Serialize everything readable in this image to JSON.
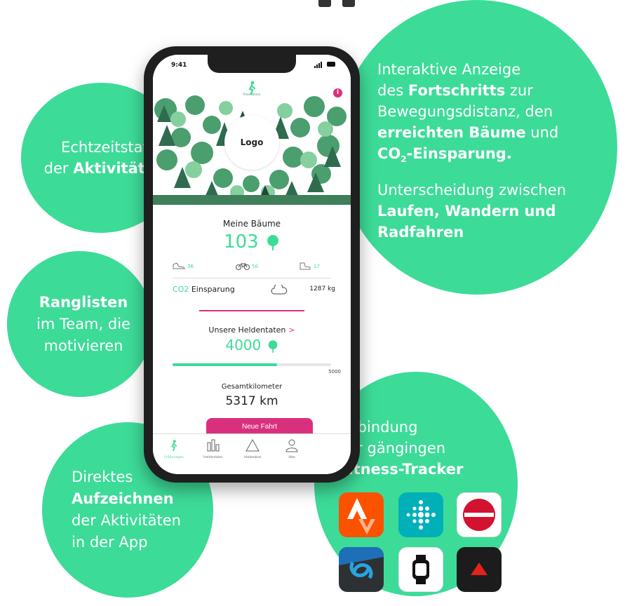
{
  "callouts": {
    "status": {
      "line1": "Echtzeitstatus",
      "line2_prefix": "der ",
      "line2_bold": "Aktivitäten"
    },
    "ranking": {
      "bold": "Ranglisten",
      "line2": "im Team, die",
      "line3": "motivieren"
    },
    "record": {
      "line1": "Direktes",
      "bold": "Aufzeichnen",
      "line3": "der Aktivitäten",
      "line4": "in der App"
    },
    "progress": {
      "line1": "Interaktive Anzeige",
      "line2_prefix": "des ",
      "line2_bold": "Fortschritts",
      "line2_suffix": " zur",
      "line3": "Bewegungsdistanz, den",
      "line4_bold": "erreichten Bäume",
      "line4_suffix": " und",
      "line5_bold_a": "CO",
      "line5_sub": "2",
      "line5_bold_b": "-Einsparung.",
      "line6": "Unterscheidung zwischen",
      "line7_bold": "Laufen, Wandern und",
      "line8_bold": "Radfahren"
    },
    "tracker": {
      "line1": "Anbindung",
      "line2": "der gängingen",
      "bold": "Fitness-Tracker"
    }
  },
  "phone": {
    "time": "9:41",
    "logo": "Logo",
    "brand": "Treemilemar",
    "info": "i",
    "trees_label": "Meine Bäume",
    "trees_value": "103",
    "activities": [
      {
        "icon": "shoe-icon",
        "value": "36"
      },
      {
        "icon": "bike-icon",
        "value": "50"
      },
      {
        "icon": "hiking-boot-icon",
        "value": "17"
      }
    ],
    "co2_prefix": "CO2",
    "co2_label": " Einsparung",
    "co2_value": "1287 kg",
    "heroes_label": "Unsere Heldentaten",
    "heroes_chevron": ">",
    "heroes_value": "4000",
    "heroes_progress": 0.66,
    "heroes_max": "5000",
    "km_label": "Gesamtkilometer",
    "km_value": "5317 km",
    "record_button": "Neue Fahrt",
    "tabs": [
      "Erfahrungen",
      "Heldentaten",
      "Heldenbrei",
      "Vibe"
    ]
  },
  "trackers": [
    "strava-icon",
    "fitbit-icon",
    "runtastic-icon",
    "garmin-connect-icon",
    "apple-watch-icon",
    "polar-icon"
  ],
  "colors": {
    "accent": "#3ddb98",
    "pink": "#d9307d",
    "forest_dark": "#2f6b4f",
    "forest_mid": "#4b9e6e",
    "forest_light": "#86cf9f"
  }
}
